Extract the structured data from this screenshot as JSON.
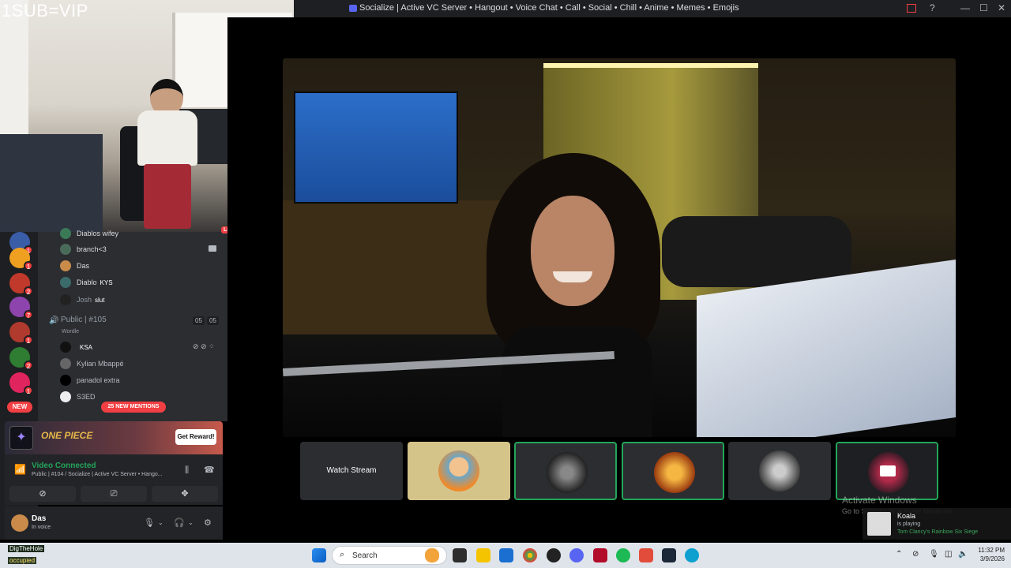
{
  "window": {
    "title": "Socialize | Active VC Server • Hangout • Voice Chat • Call • Social • Chill • Anime • Memes • Emojis",
    "minimize": "—",
    "maximize": "☐",
    "close": "✕"
  },
  "overlay": {
    "vip_text": "1SUB=VIP"
  },
  "guild_rail": {
    "badges": [
      "1",
      "1",
      "2",
      "7",
      "1",
      "2",
      "1"
    ],
    "new_label": "NEW"
  },
  "voice_channel_users": [
    {
      "name": "Diablos wifey",
      "tag": "",
      "live": "LIVE"
    },
    {
      "name": "branch<3",
      "tag": ""
    },
    {
      "name": "Das",
      "tag": ""
    },
    {
      "name": "Diablo",
      "tag": "KYS"
    },
    {
      "name": "Josh",
      "tag": "slut"
    }
  ],
  "public_channel": {
    "name": "Public | #105",
    "count_a": "05",
    "count_b": "05",
    "activity": "Wordle",
    "users": [
      {
        "name": "",
        "tag": "KSA"
      },
      {
        "name": "Kylian Mbappé",
        "tag": ""
      },
      {
        "name": "panadol extra",
        "tag": ""
      },
      {
        "name": "S3ED",
        "tag": ""
      }
    ]
  },
  "mentions_pill": "25 NEW MENTIONS",
  "promo": {
    "game_name": "ONE PIECE",
    "button": "Get Reward!"
  },
  "voice_panel": {
    "status": "Video Connected",
    "location": "Public | #104 / Socialize | Active VC Server • Hango..."
  },
  "user_panel": {
    "name": "Das",
    "status": "In voice"
  },
  "stream": {
    "watch_button": "Watch Stream"
  },
  "windows_watermark": {
    "title": "Activate Windows",
    "subtitle": "Go to Settings to activate Windows."
  },
  "toast": {
    "name": "Koala",
    "status": "is playing",
    "game": "Tom Clancy's Rainbow Six Siege"
  },
  "taskbar": {
    "search_placeholder": "Search",
    "time": "11:32 PM",
    "date": "3/9/2026"
  },
  "streamer_overlay": {
    "name": "DigTheHole",
    "sub": "occupied"
  },
  "colors": {
    "accent": "#5865f2",
    "online": "#23a55a",
    "danger": "#f23f43",
    "panel": "#2b2d31"
  }
}
